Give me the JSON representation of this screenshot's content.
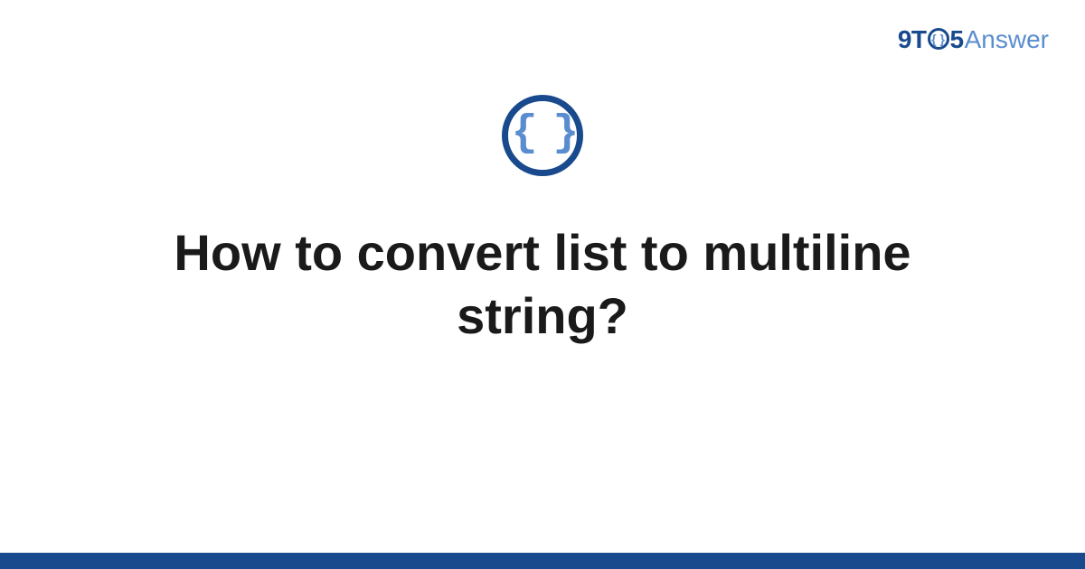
{
  "logo": {
    "part1": "9T",
    "circle": "{ }",
    "part2": "5",
    "part3": "Answer"
  },
  "icon": {
    "name": "code-braces-icon",
    "glyph": "{ }"
  },
  "question": {
    "title": "How to convert list to multiline string?"
  },
  "colors": {
    "primary": "#194a8d",
    "accent": "#5a8dcf"
  }
}
